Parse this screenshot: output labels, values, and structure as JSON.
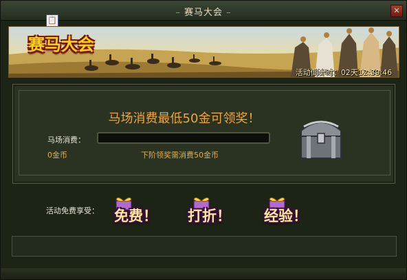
{
  "window": {
    "title": "赛马大会",
    "close_label": "✕"
  },
  "clip_icon": "clipboard-icon",
  "banner": {
    "title": "赛马大会",
    "countdown_label": "活动倒计时：",
    "countdown_value": "02天12:39:46"
  },
  "main": {
    "headline": "马场消费最低50金可领奖！",
    "consume_label": "马场消费：",
    "consume_value": "0金币",
    "next_tier_text": "下阶领奖需消费50金币",
    "progress_fraction": 0
  },
  "perks": {
    "label": "活动免费享受：",
    "items": [
      {
        "label": "免费！"
      },
      {
        "label": "打折！"
      },
      {
        "label": "经验！"
      }
    ]
  },
  "colors": {
    "accent_gold": "#ffd21a",
    "headline": "#f0a53a",
    "label_white": "#e6e6d6",
    "value_gold": "#e3b049"
  }
}
